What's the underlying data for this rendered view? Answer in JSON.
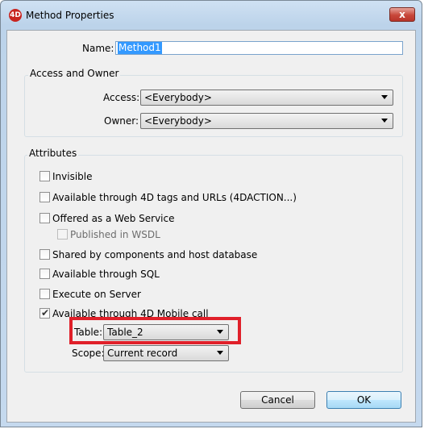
{
  "window": {
    "title": "Method Properties",
    "app_icon_text": "4D",
    "close_label": "x"
  },
  "name": {
    "label": "Name:",
    "value": "Method1"
  },
  "access_owner": {
    "title": "Access and Owner",
    "access_label": "Access:",
    "access_value": "<Everybody>",
    "owner_label": "Owner:",
    "owner_value": "<Everybody>"
  },
  "attributes": {
    "title": "Attributes",
    "checkboxes": [
      {
        "label": "Invisible",
        "checked": false,
        "enabled": true
      },
      {
        "label": "Available through 4D tags and URLs (4DACTION...)",
        "checked": false,
        "enabled": true
      },
      {
        "label": "Offered as a Web Service",
        "checked": false,
        "enabled": true
      },
      {
        "label": "Published in WSDL",
        "checked": false,
        "enabled": false
      },
      {
        "label": "Shared by components and host database",
        "checked": false,
        "enabled": true
      },
      {
        "label": "Available through SQL",
        "checked": false,
        "enabled": true
      },
      {
        "label": "Execute on Server",
        "checked": false,
        "enabled": true
      },
      {
        "label": "Available through 4D Mobile call",
        "checked": true,
        "enabled": true
      }
    ],
    "table_label": "Table:",
    "table_value": "Table_2",
    "scope_label": "Scope:",
    "scope_value": "Current record"
  },
  "buttons": {
    "cancel": "Cancel",
    "ok": "OK"
  },
  "colors": {
    "highlight": "#e0202a",
    "selection": "#3399ff",
    "close_button": "#c8473a"
  }
}
